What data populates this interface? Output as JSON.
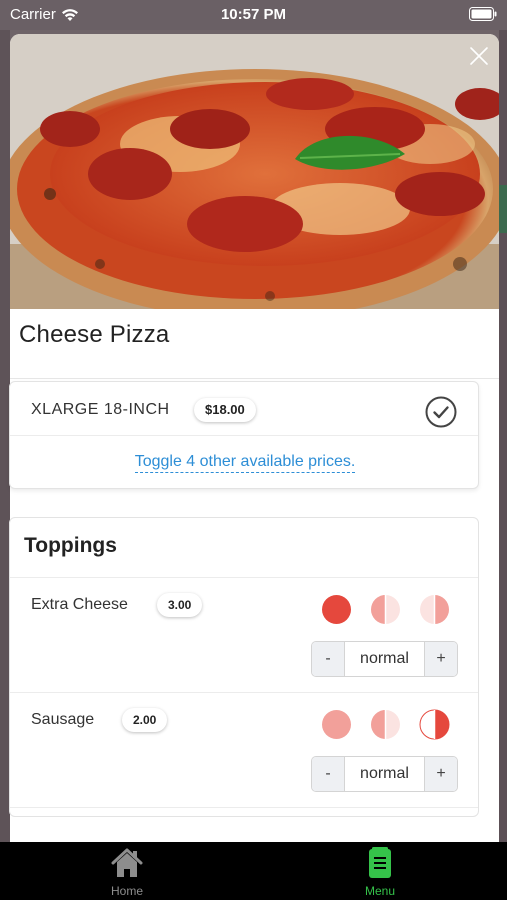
{
  "status_bar": {
    "carrier": "Carrier",
    "time": "10:57 PM"
  },
  "item": {
    "title": "Cheese Pizza",
    "image_icon": "pizza-photo"
  },
  "pricing": {
    "size_label": "XLARGE 18-INCH",
    "price": "$18.00",
    "toggle_link": "Toggle 4 other available prices."
  },
  "toppings": {
    "heading": "Toppings",
    "items": [
      {
        "name": "Extra Cheese",
        "price": "3.00",
        "portion_selected": "whole",
        "quantity": "normal",
        "minus_label": "-",
        "plus_label": "+"
      },
      {
        "name": "Sausage",
        "price": "2.00",
        "portion_selected": "right-half",
        "quantity": "normal",
        "minus_label": "-",
        "plus_label": "+"
      }
    ]
  },
  "tab_bar": {
    "tabs": [
      {
        "label": "Home",
        "icon": "house-icon",
        "active": false
      },
      {
        "label": "Menu",
        "icon": "menu-book-icon",
        "active": true
      }
    ]
  },
  "colors": {
    "accent_red": "#e5483d",
    "faded_red": "#f2a09a",
    "link_blue": "#2d8ed6",
    "active_tab_green": "#35c24a"
  }
}
